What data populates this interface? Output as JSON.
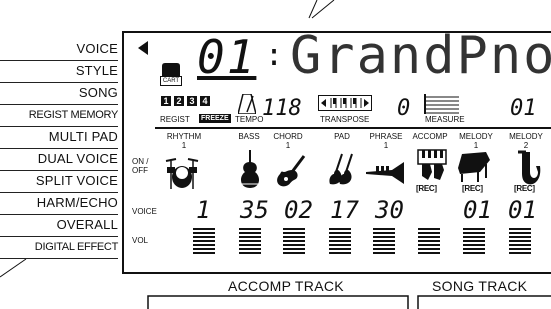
{
  "menu": {
    "items": [
      {
        "label": "VOICE"
      },
      {
        "label": "STYLE"
      },
      {
        "label": "SONG"
      },
      {
        "label": "REGIST MEMORY"
      },
      {
        "label": "MULTI PAD"
      },
      {
        "label": "DUAL VOICE"
      },
      {
        "label": "SPLIT VOICE"
      },
      {
        "label": "HARM/ECHO"
      },
      {
        "label": "OVERALL"
      },
      {
        "label": "DIGITAL EFFECT"
      }
    ]
  },
  "display": {
    "cart_label": "CART",
    "voice_number": "01",
    "voice_name": "GrandPno",
    "regist_label": "REGIST",
    "freeze_label": "FREEZE",
    "regist_numbers": [
      "1",
      "2",
      "3",
      "4"
    ],
    "tempo_label": "TEMPO",
    "tempo_value": "118",
    "transpose_label": "TRANSPOSE",
    "transpose_value": "0",
    "measure_label": "MEASURE",
    "measure_value": "01",
    "on_off_label": "ON / OFF",
    "voice_row_label": "VOICE",
    "vol_row_label": "VOL",
    "rec_label": "[REC]",
    "tracks": [
      {
        "name": "RHYTHM",
        "sub": "1",
        "voice": "1",
        "icon": "drum-kit-icon"
      },
      {
        "name": "BASS",
        "sub": "",
        "voice": "35",
        "icon": "double-bass-icon"
      },
      {
        "name": "CHORD",
        "sub": "1",
        "voice": "02",
        "icon": "guitar-icon"
      },
      {
        "name": "PAD",
        "sub": "",
        "voice": "17",
        "icon": "strings-icon"
      },
      {
        "name": "PHRASE",
        "sub": "1",
        "voice": "30",
        "icon": "trumpet-icon"
      },
      {
        "name": "ACCOMP",
        "sub": "",
        "voice": "",
        "icon": "hands-keyboard-icon"
      },
      {
        "name": "MELODY",
        "sub": "1",
        "voice": "01",
        "icon": "grand-piano-icon"
      },
      {
        "name": "MELODY",
        "sub": "2",
        "voice": "01",
        "icon": "saxophone-icon"
      }
    ]
  },
  "sections": {
    "accomp_track": "ACCOMP TRACK",
    "song_track": "SONG TRACK"
  }
}
